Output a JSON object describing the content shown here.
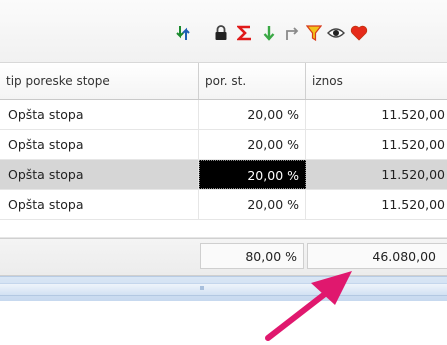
{
  "toolbar": {
    "icons": [
      "swap-arrows-icon",
      "lock-icon",
      "sum-icon",
      "download-arrow-icon",
      "export-arrow-icon",
      "filter-icon",
      "eye-icon",
      "heart-icon"
    ]
  },
  "table": {
    "columns": [
      "tip poreske stope",
      "por. st.",
      "iznos"
    ],
    "rows": [
      {
        "name": "Opšta stopa",
        "rate": "20,00 %",
        "amount": "11.520,00"
      },
      {
        "name": "Opšta stopa",
        "rate": "20,00 %",
        "amount": "11.520,00"
      },
      {
        "name": "Opšta stopa",
        "rate": "20,00 %",
        "amount": "11.520,00"
      },
      {
        "name": "Opšta stopa",
        "rate": "20,00 %",
        "amount": "11.520,00"
      }
    ],
    "selected_row": 3,
    "totals": {
      "rate": "80,00 %",
      "amount": "46.080,00"
    }
  },
  "colors": {
    "accent_arrow": "#e0186e",
    "selection_row": "#d6d6d6",
    "focus_cell": "#000000",
    "scrollbar": "#c7d9ef"
  }
}
